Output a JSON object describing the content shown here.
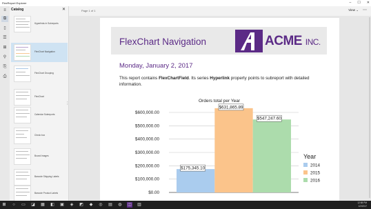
{
  "window": {
    "title": "FlexReport Explorer"
  },
  "toolbar": {
    "page_indicator": "Page 1 of 1",
    "view_label": "View",
    "view_chevron": "⌄",
    "more": "⋯"
  },
  "catalog": {
    "header": "Catalog",
    "items": [
      {
        "label": "Hyperlinks in Subreports"
      },
      {
        "label": "FlexChart Navigation"
      },
      {
        "label": "FlexChart Grouping"
      },
      {
        "label": "FlexChart"
      },
      {
        "label": "Calendar Subreports"
      },
      {
        "label": "Check box"
      },
      {
        "label": "Bound Images"
      },
      {
        "label": "Barcode Shipping Labels"
      },
      {
        "label": "Barcode Product Labels"
      }
    ],
    "selected_index": 1
  },
  "report": {
    "title": "FlexChart Navigation",
    "logo_text": "ACME",
    "logo_suffix": "INC.",
    "date": "Monday, January 2, 2017",
    "desc_pre": "This report contains ",
    "desc_field": "FlexChartField",
    "desc_mid": ". Its series ",
    "desc_prop": "Hyperlink",
    "desc_post": " property points to subreport with detailed information."
  },
  "chart_data": {
    "type": "bar",
    "title": "Orders total per Year",
    "categories": [
      "2014",
      "2015",
      "2016"
    ],
    "values": [
      175345.1,
      631865.89,
      547247.6
    ],
    "data_labels": [
      "$175,345.10",
      "$631,865.89",
      "$547,247.60"
    ],
    "colors": [
      "#aaccee",
      "#fbc48b",
      "#acdcac"
    ],
    "legend_title": "Year",
    "legend_position": "right",
    "ylim": [
      0,
      600000
    ],
    "yticks": [
      "$0.00",
      "$100,000.00",
      "$200,000.00",
      "$300,000.00",
      "$400,000.00",
      "$500,000.00",
      "$600,000.00"
    ],
    "grid": true
  },
  "taskbar": {
    "time": "12:58 PM",
    "date": "1/2/2017"
  },
  "colors": {
    "accent": "#5b2a86",
    "selection": "#cfe3f3"
  }
}
